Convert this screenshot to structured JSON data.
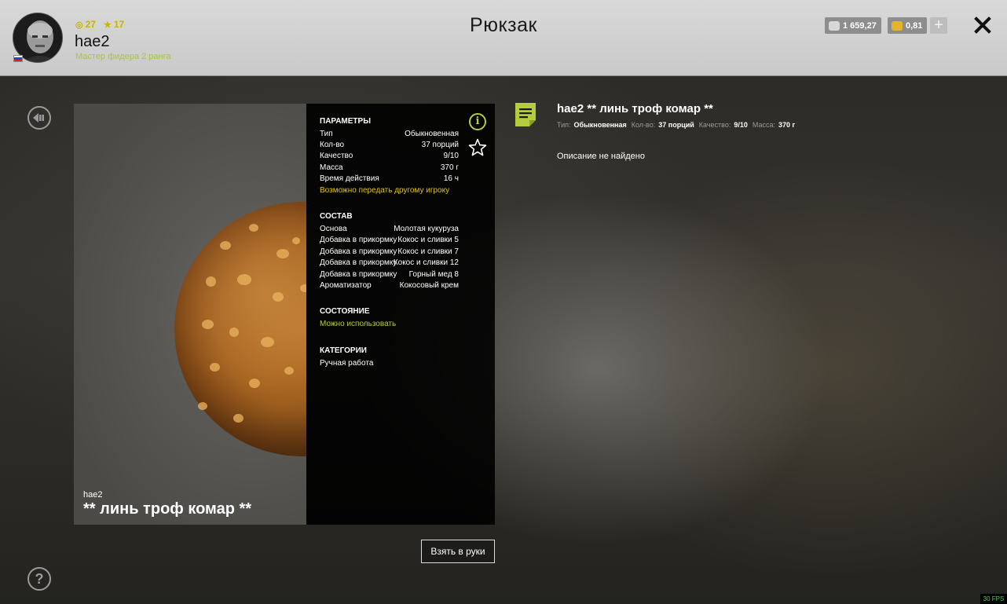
{
  "header": {
    "title": "Рюкзак",
    "username": "hae2",
    "rank": "Мастер фидера 2 ранга",
    "stat_level": "27",
    "stat_stars": "17",
    "silver": "1 659,27",
    "gold": "0,81",
    "plus": "+"
  },
  "colors": {
    "accent_yellow": "#e0c016",
    "accent_green": "#b5cc3c"
  },
  "card": {
    "owner": "hae2",
    "name": "** линь троф комар **"
  },
  "params": {
    "heading": "ПАРАМЕТРЫ",
    "rows": [
      {
        "k": "Тип",
        "v": "Обыкновенная"
      },
      {
        "k": "Кол-во",
        "v": "37 порций"
      },
      {
        "k": "Качество",
        "v": "9/10"
      },
      {
        "k": "Масса",
        "v": "370 г"
      },
      {
        "k": "Время действия",
        "v": "16 ч"
      }
    ],
    "transfer_note": "Возможно передать другому игроку"
  },
  "composition": {
    "heading": "СОСТАВ",
    "rows": [
      {
        "k": "Основа",
        "v": "Молотая кукуруза"
      },
      {
        "k": "Добавка в прикормку",
        "v": "Кокос и сливки 5"
      },
      {
        "k": "Добавка в прикормку",
        "v": "Кокос и сливки 7"
      },
      {
        "k": "Добавка в прикормку",
        "v": "Кокос и сливки 12"
      },
      {
        "k": "Добавка в прикормку",
        "v": "Горный мед 8"
      },
      {
        "k": "Ароматизатор",
        "v": "Кокосовый крем"
      }
    ]
  },
  "state": {
    "heading": "СОСТОЯНИЕ",
    "value": "Можно использовать"
  },
  "categories": {
    "heading": "КАТЕГОРИИ",
    "value": "Ручная работа"
  },
  "take_button": "Взять в руки",
  "description": {
    "title": "hae2 ** линь троф комар **",
    "meta": [
      {
        "k": "Тип:",
        "v": "Обыкновенная"
      },
      {
        "k": "Кол-во:",
        "v": "37 порций"
      },
      {
        "k": "Качество:",
        "v": "9/10"
      },
      {
        "k": "Масса:",
        "v": "370 г"
      }
    ],
    "text": "Описание не найдено"
  },
  "fps": "30 FPS",
  "icons": {
    "back": "back-icon",
    "help": "help-icon",
    "info": "info-icon",
    "favorite": "star-icon",
    "note": "note-icon",
    "close": "close-icon"
  },
  "help_glyph": "?",
  "info_glyph": "i"
}
